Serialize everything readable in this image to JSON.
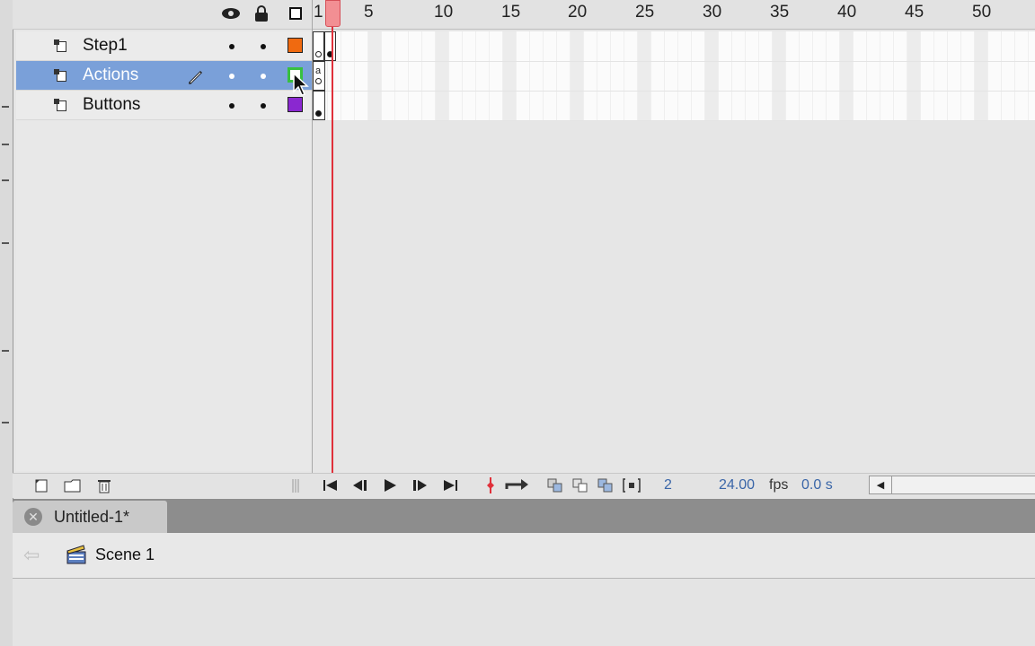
{
  "header": {
    "eye_icon": "eye-icon",
    "lock_icon": "lock-icon",
    "outline_icon": "outline-square-icon"
  },
  "layers": [
    {
      "name": "Step1",
      "color": "#f06a10",
      "outline": false,
      "selected": false
    },
    {
      "name": "Actions",
      "color": "#38c040",
      "outline": true,
      "selected": true
    },
    {
      "name": "Buttons",
      "color": "#8a28d0",
      "outline": false,
      "selected": false
    }
  ],
  "timeline": {
    "ruler_labels": [
      "1",
      "5",
      "10",
      "15",
      "20",
      "25",
      "30",
      "35",
      "40",
      "45",
      "50"
    ],
    "current_frame": "2",
    "fps": "24.00",
    "fps_unit": "fps",
    "elapsed": "0.0 s",
    "playhead_color": "#e0303a"
  },
  "controls": {
    "new_layer": "new-layer-icon",
    "new_folder": "new-folder-icon",
    "delete": "trash-icon",
    "first_frame": "first-frame-icon",
    "step_back": "step-back-icon",
    "play": "play-icon",
    "step_forward": "step-forward-icon",
    "last_frame": "last-frame-icon",
    "center_frame": "center-frame-icon",
    "loop": "loop-icon",
    "onion_skin": "onion-skin-icon",
    "onion_outlines": "onion-outlines-icon",
    "edit_multiple": "edit-multiple-frames-icon",
    "modify_markers": "modify-markers-icon"
  },
  "document": {
    "tab_title": "Untitled-1*",
    "scene": "Scene 1"
  },
  "colors": {
    "selection": "#7aa0d9",
    "tab_bar": "#8d8d8d"
  }
}
